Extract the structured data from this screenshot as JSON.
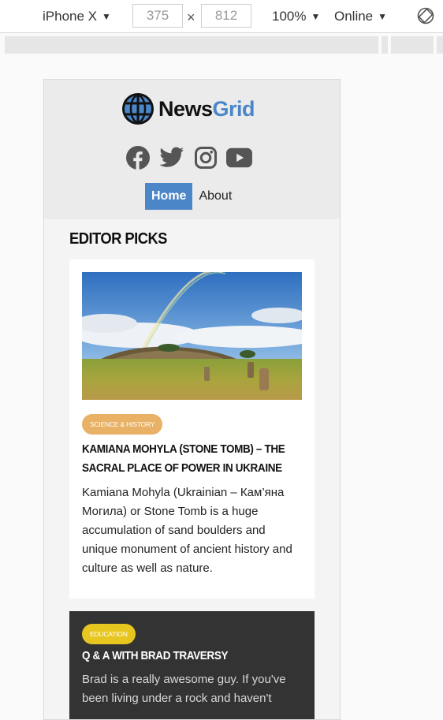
{
  "devtools": {
    "device": "iPhone X",
    "width": "375",
    "height": "812",
    "times": "×",
    "zoom": "100%",
    "network": "Online"
  },
  "site": {
    "logo_part1": "News",
    "logo_part2": "Grid",
    "social_icons": [
      "facebook-icon",
      "twitter-icon",
      "instagram-icon",
      "youtube-icon"
    ],
    "nav": [
      {
        "label": "Home",
        "active": true
      },
      {
        "label": "About",
        "active": false
      }
    ],
    "colors": {
      "accent": "#4a86c8",
      "science_badge": "#e8b165",
      "education_badge": "#e7c620",
      "dark_card": "#333333"
    }
  },
  "section": {
    "title": "EDITOR PICKS"
  },
  "articles": [
    {
      "category": "SCIENCE & HISTORY",
      "title": "KAMIANA MOHYLA (STONE TOMB) – THE SACRAL PLACE OF POWER IN UKRAINE",
      "text": "Kamiana Mohyla (Ukrainian – Кам’яна Могила) or Stone Tomb is a huge accumulation of sand boulders and unique monument of ancient history and culture as well as nature."
    },
    {
      "category": "EDUCATION",
      "title": "Q & A WITH BRAD TRAVERSY",
      "text": "Brad is a really awesome guy. If you've been living under a rock and haven't"
    }
  ]
}
